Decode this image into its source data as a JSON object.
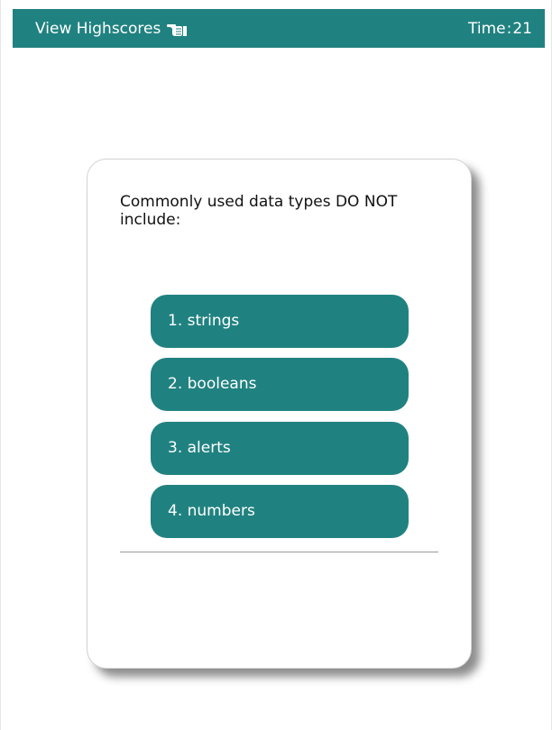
{
  "header": {
    "highscores_label": "View Highscores",
    "highscores_icon": "pointing-hand-icon",
    "timer_label": "Time",
    "timer_separator": ":",
    "timer_value": "21",
    "background_color": "#208280"
  },
  "quiz": {
    "question": "Commonly used data types DO NOT include:",
    "answers": [
      {
        "label": "1. strings"
      },
      {
        "label": "2. booleans"
      },
      {
        "label": "3. alerts"
      },
      {
        "label": "4. numbers"
      }
    ],
    "answer_color": "#208280"
  }
}
